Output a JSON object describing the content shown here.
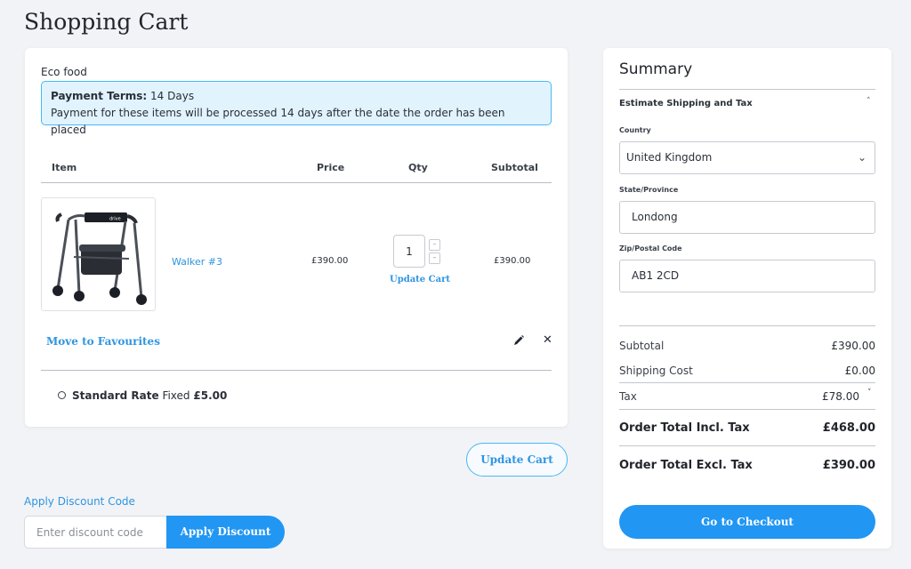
{
  "page": {
    "title": "Shopping Cart"
  },
  "cart": {
    "seller": "Eco food",
    "payment_terms": {
      "label": "Payment Terms:",
      "value": "14 Days",
      "description": "Payment for these items will be processed 14 days after the date the order has been placed"
    },
    "columns": [
      "Item",
      "Price",
      "Qty",
      "Subtotal"
    ],
    "items": [
      {
        "name": "Walker #3",
        "price": "£390.00",
        "qty": "1",
        "subtotal": "£390.00",
        "update_label": "Update Cart",
        "move_label": "Move to Favourites",
        "image_icon": "rollator-walker-image"
      }
    ],
    "shipping_option": {
      "name": "Standard Rate",
      "type": "Fixed",
      "price": "£5.00"
    },
    "update_cart_button": "Update Cart"
  },
  "discount": {
    "toggle_label": "Apply Discount Code",
    "placeholder": "Enter discount code",
    "button_label": "Apply Discount"
  },
  "summary": {
    "title": "Summary",
    "estimate_heading": "Estimate Shipping and Tax",
    "country_label": "Country",
    "country_value": "United Kingdom",
    "state_label": "State/Province",
    "state_value": "Londong",
    "zip_label": "Zip/Postal Code",
    "zip_value": "AB1 2CD",
    "subtotal_label": "Subtotal",
    "subtotal_value": "£390.00",
    "shipping_label": "Shipping Cost",
    "shipping_value": "£0.00",
    "tax_label": "Tax",
    "tax_value": "£78.00",
    "total_incl_label": "Order Total Incl. Tax",
    "total_incl_value": "£468.00",
    "total_excl_label": "Order Total Excl. Tax",
    "total_excl_value": "£390.00",
    "checkout_button": "Go to Checkout"
  },
  "colors": {
    "accent": "#2196f3",
    "link": "#2f95e0",
    "notice_bg": "#e1f3fd",
    "notice_border": "#49b8f2"
  }
}
